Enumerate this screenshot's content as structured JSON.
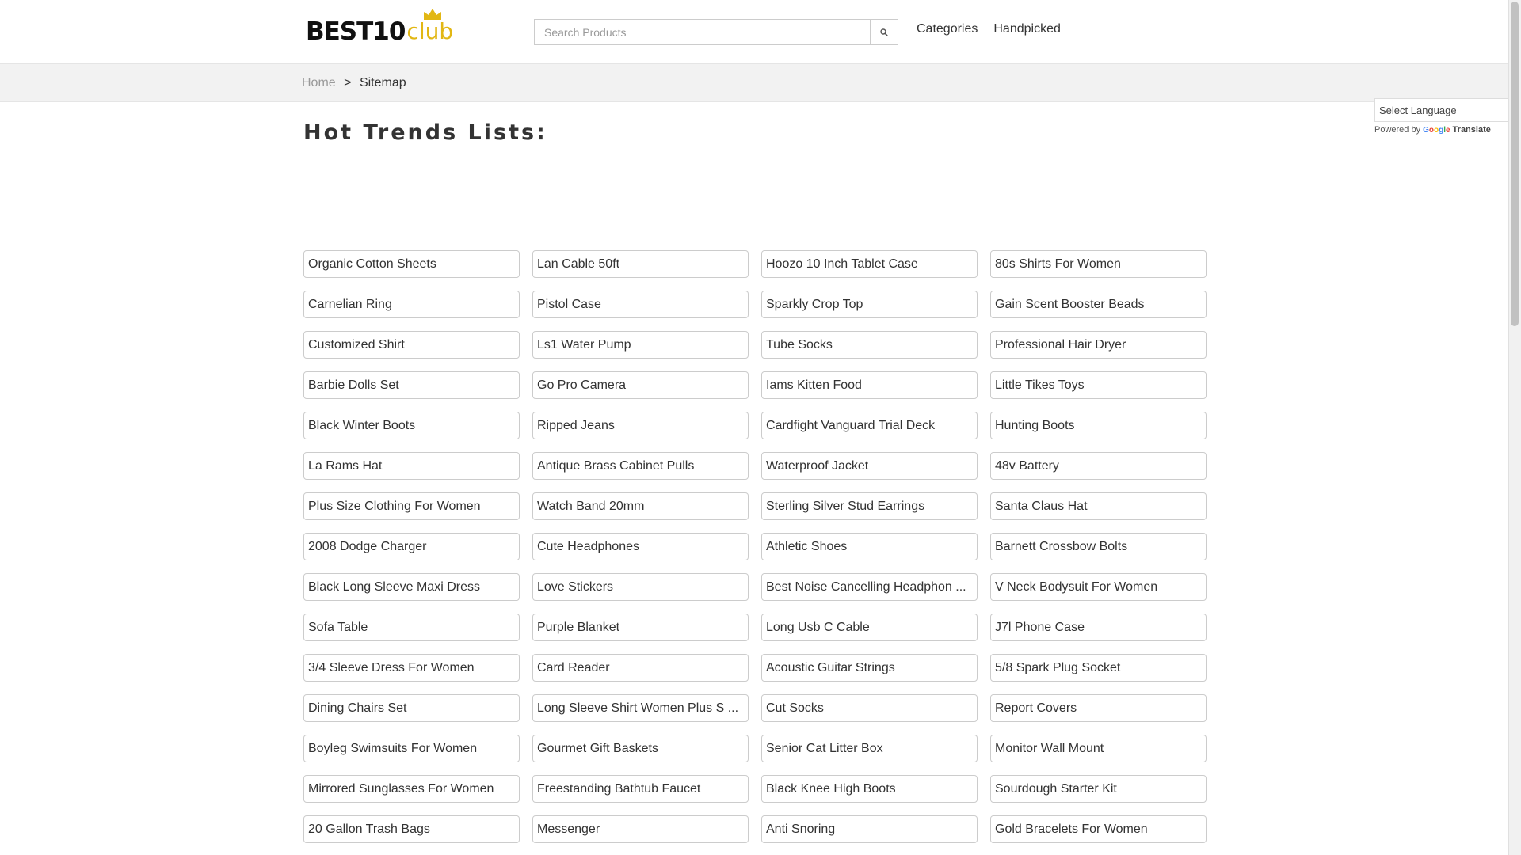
{
  "logo": {
    "best": "BEST10",
    "club": "club"
  },
  "search": {
    "placeholder": "Search Products",
    "icon": "search-icon"
  },
  "nav": {
    "categories": "Categories",
    "handpicked": "Handpicked"
  },
  "breadcrumb": {
    "home": "Home",
    "separator": ">",
    "current": "Sitemap"
  },
  "page": {
    "heading": "Hot Trends Lists:"
  },
  "translate": {
    "select_label": "Select Language",
    "powered_by": "Powered by",
    "google": "Google",
    "translate": "Translate"
  },
  "colors": {
    "logo_accent": "#e2b714",
    "breadcrumb_bg": "#f2f2f2",
    "cell_border": "#cccccc"
  },
  "trends": [
    "Organic Cotton Sheets",
    "Lan Cable 50ft",
    "Hoozo 10 Inch Tablet Case",
    "80s Shirts For Women",
    "Carnelian Ring",
    "Pistol Case",
    "Sparkly Crop Top",
    "Gain Scent Booster Beads",
    "Customized Shirt",
    "Ls1 Water Pump",
    "Tube Socks",
    "Professional Hair Dryer",
    "Barbie Dolls Set",
    "Go Pro Camera",
    "Iams Kitten Food",
    "Little Tikes Toys",
    "Black Winter Boots",
    "Ripped Jeans",
    "Cardfight Vanguard Trial Deck",
    "Hunting Boots",
    "La Rams Hat",
    "Antique Brass Cabinet Pulls",
    "Waterproof Jacket",
    "48v Battery",
    "Plus Size Clothing For Women",
    "Watch Band 20mm",
    "Sterling Silver Stud Earrings",
    "Santa Claus Hat",
    "2008 Dodge Charger",
    "Cute Headphones",
    "Athletic Shoes",
    "Barnett Crossbow Bolts",
    "Black Long Sleeve Maxi Dress",
    "Love Stickers",
    "Best Noise Cancelling Headphon ...",
    "V Neck Bodysuit For Women",
    "Sofa Table",
    "Purple Blanket",
    "Long Usb C Cable",
    "J7l Phone Case",
    "3/4 Sleeve Dress For Women",
    "Card Reader",
    "Acoustic Guitar Strings",
    "5/8 Spark Plug Socket",
    "Dining Chairs Set",
    "Long Sleeve Shirt Women Plus S ...",
    "Cut Socks",
    "Report Covers",
    "Boyleg Swimsuits For Women",
    "Gourmet Gift Baskets",
    "Senior Cat Litter Box",
    "Monitor Wall Mount",
    "Mirrored Sunglasses For Women",
    "Freestanding Bathtub Faucet",
    "Black Knee High Boots",
    "Sourdough Starter Kit",
    "20 Gallon Trash Bags",
    "Messenger",
    "Anti Snoring",
    "Gold Bracelets For Women"
  ]
}
